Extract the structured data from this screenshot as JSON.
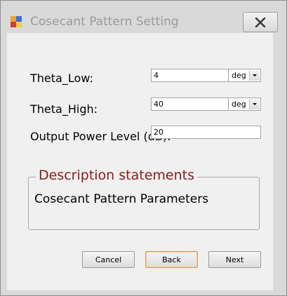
{
  "window": {
    "title": "Cosecant Pattern Setting"
  },
  "form": {
    "theta_low": {
      "label": "Theta_Low:",
      "value": "4",
      "unit": "deg"
    },
    "theta_high": {
      "label": "Theta_High:",
      "value": "40",
      "unit": "deg"
    },
    "output_power": {
      "label": "Output Power Level (dB):",
      "value": "20"
    }
  },
  "description": {
    "legend": "Description statements",
    "text": "Cosecant Pattern Parameters"
  },
  "buttons": {
    "cancel": "Cancel",
    "back": "Back",
    "next": "Next"
  }
}
